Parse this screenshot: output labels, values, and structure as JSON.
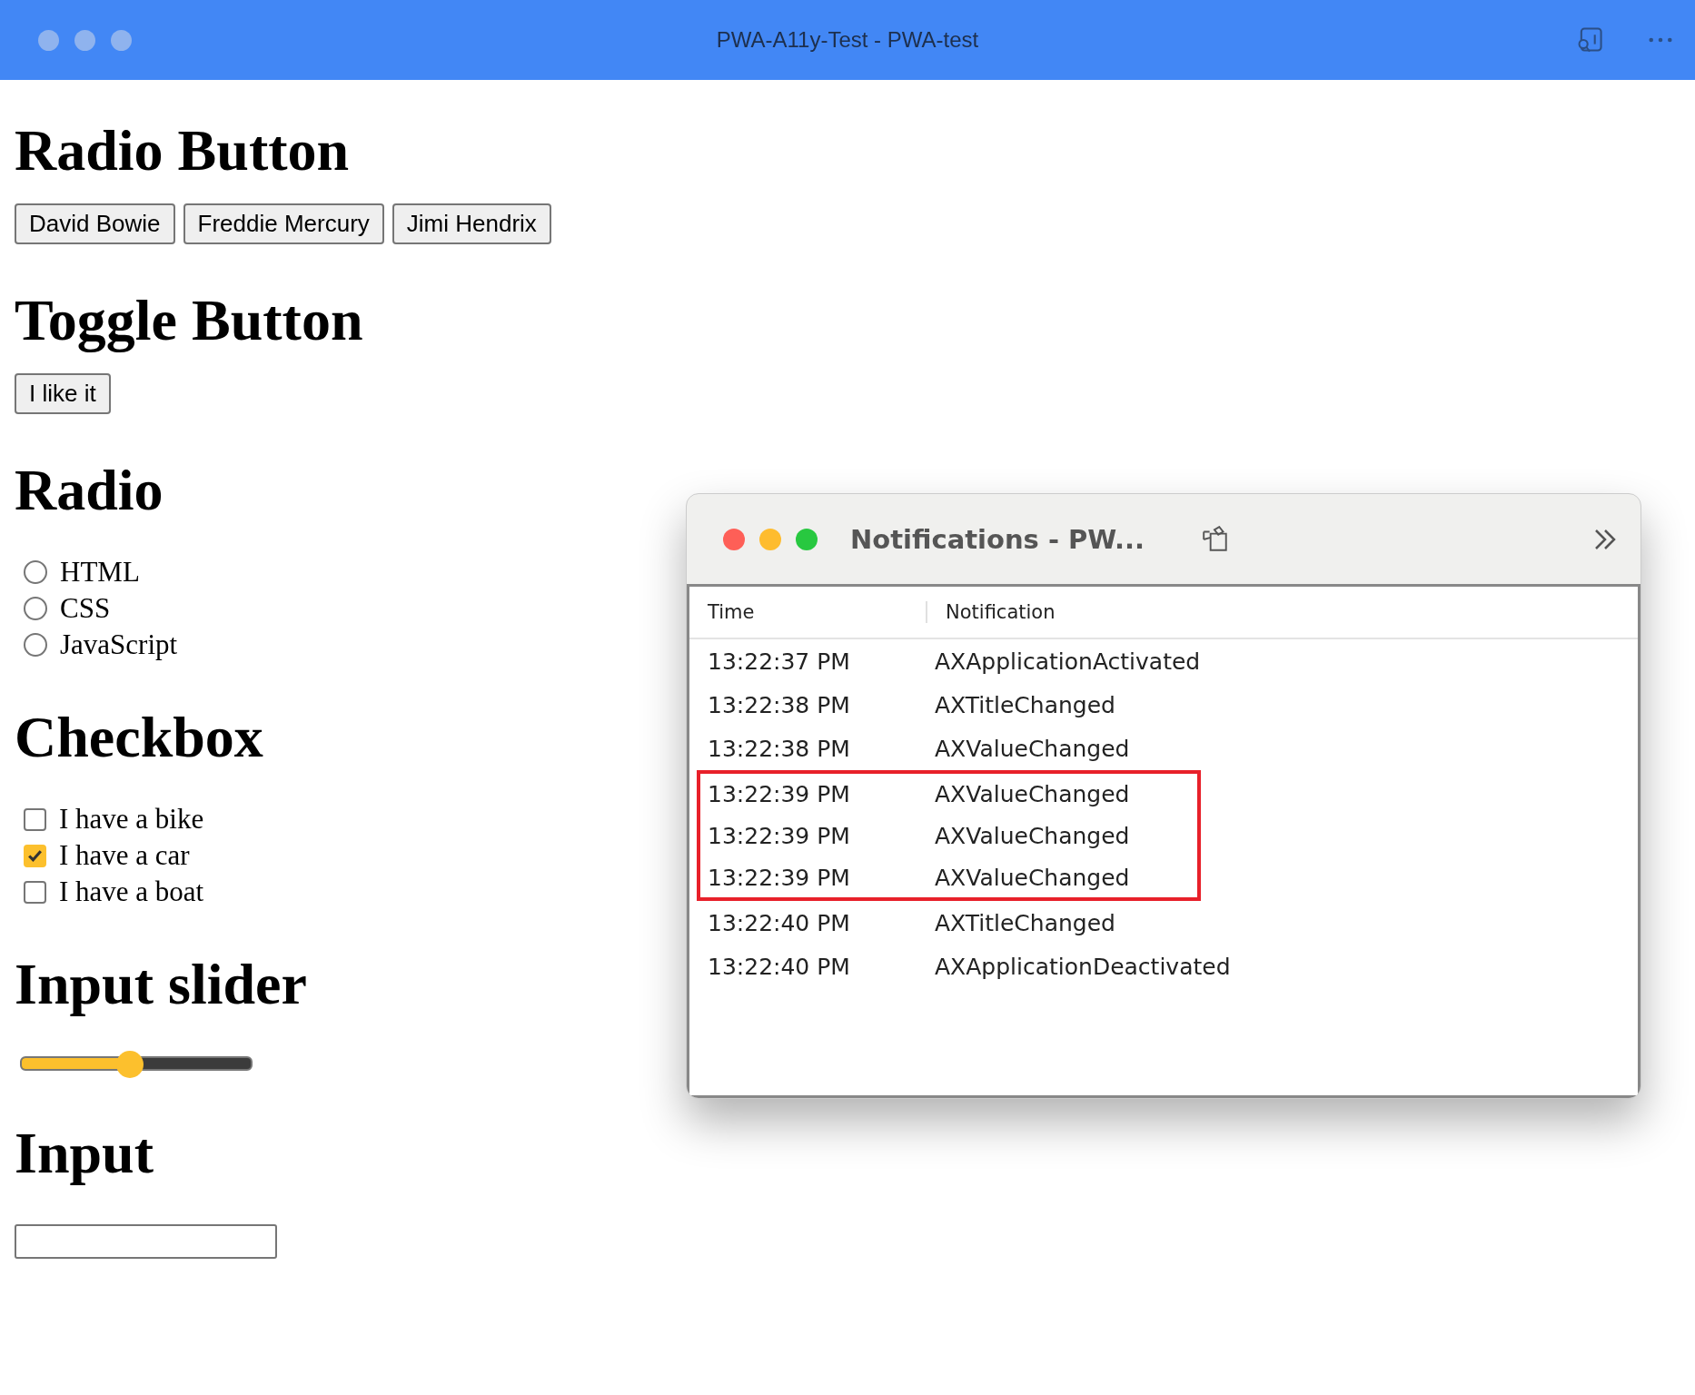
{
  "window": {
    "title": "PWA-A11y-Test - PWA-test"
  },
  "sections": [
    {
      "kind": "buttons",
      "heading": "Radio Button",
      "buttons": [
        "David Bowie",
        "Freddie Mercury",
        "Jimi Hendrix"
      ]
    },
    {
      "kind": "buttons",
      "heading": "Toggle Button",
      "buttons": [
        "I like it"
      ]
    },
    {
      "kind": "radio",
      "heading": "Radio",
      "options": [
        {
          "label": "HTML",
          "selected": false
        },
        {
          "label": "CSS",
          "selected": false
        },
        {
          "label": "JavaScript",
          "selected": false
        }
      ]
    },
    {
      "kind": "checkbox",
      "heading": "Checkbox",
      "options": [
        {
          "label": "I have a bike",
          "checked": false
        },
        {
          "label": "I have a car",
          "checked": true
        },
        {
          "label": "I have a boat",
          "checked": false
        }
      ]
    },
    {
      "kind": "slider",
      "heading": "Input slider",
      "level": 0.46
    },
    {
      "kind": "input",
      "heading": "Input"
    }
  ],
  "notifications": {
    "title": "Notifications - PW...",
    "columns": [
      "Time",
      "Notification"
    ],
    "rows": [
      {
        "time": "13:22:37 PM",
        "notification": "AXApplicationActivated",
        "highlighted": false
      },
      {
        "time": "13:22:38 PM",
        "notification": "AXTitleChanged",
        "highlighted": false
      },
      {
        "time": "13:22:38 PM",
        "notification": "AXValueChanged",
        "highlighted": false
      },
      {
        "time": "13:22:39 PM",
        "notification": "AXValueChanged",
        "highlighted": true
      },
      {
        "time": "13:22:39 PM",
        "notification": "AXValueChanged",
        "highlighted": true
      },
      {
        "time": "13:22:39 PM",
        "notification": "AXValueChanged",
        "highlighted": true
      },
      {
        "time": "13:22:40 PM",
        "notification": "AXTitleChanged",
        "highlighted": false
      },
      {
        "time": "13:22:40 PM",
        "notification": "AXApplicationDeactivated",
        "highlighted": false
      }
    ]
  }
}
